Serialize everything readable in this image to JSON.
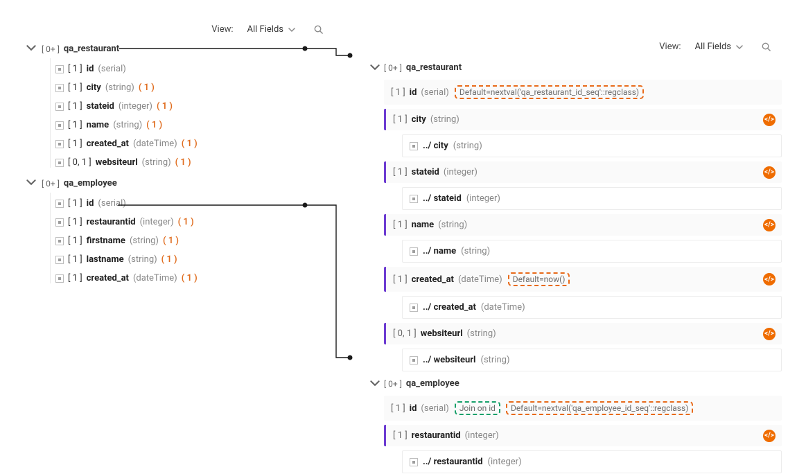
{
  "toolbar": {
    "view_label": "View:",
    "selected": "All Fields"
  },
  "left": {
    "groups": [
      {
        "card": "[ 0+ ]",
        "name": "qa_restaurant",
        "fields": [
          {
            "card": "[ 1 ]",
            "name": "id",
            "type": "(serial)",
            "count": ""
          },
          {
            "card": "[ 1 ]",
            "name": "city",
            "type": "(string)",
            "count": "( 1 )"
          },
          {
            "card": "[ 1 ]",
            "name": "stateid",
            "type": "(integer)",
            "count": "( 1 )"
          },
          {
            "card": "[ 1 ]",
            "name": "name",
            "type": "(string)",
            "count": "( 1 )"
          },
          {
            "card": "[ 1 ]",
            "name": "created_at",
            "type": "(dateTime)",
            "count": "( 1 )"
          },
          {
            "card": "[ 0, 1 ]",
            "name": "websiteurl",
            "type": "(string)",
            "count": "( 1 )"
          }
        ]
      },
      {
        "card": "[ 0+ ]",
        "name": "qa_employee",
        "fields": [
          {
            "card": "[ 1 ]",
            "name": "id",
            "type": "(serial)",
            "count": ""
          },
          {
            "card": "[ 1 ]",
            "name": "restaurantid",
            "type": "(integer)",
            "count": "( 1 )"
          },
          {
            "card": "[ 1 ]",
            "name": "firstname",
            "type": "(string)",
            "count": "( 1 )"
          },
          {
            "card": "[ 1 ]",
            "name": "lastname",
            "type": "(string)",
            "count": "( 1 )"
          },
          {
            "card": "[ 1 ]",
            "name": "created_at",
            "type": "(dateTime)",
            "count": "( 1 )"
          }
        ]
      }
    ]
  },
  "right": {
    "groups": [
      {
        "card": "[ 0+ ]",
        "name": "qa_restaurant",
        "fields": [
          {
            "card": "[ 1 ]",
            "name": "id",
            "type": "(serial)",
            "annot_orange": "Default=nextval('qa_restaurant_id_seq'::regclass)"
          },
          {
            "card": "[ 1 ]",
            "name": "city",
            "type": "(string)",
            "badge": true,
            "child": {
              "path": "../ city",
              "type": "(string)"
            }
          },
          {
            "card": "[ 1 ]",
            "name": "stateid",
            "type": "(integer)",
            "badge": true,
            "child": {
              "path": "../ stateid",
              "type": "(integer)"
            }
          },
          {
            "card": "[ 1 ]",
            "name": "name",
            "type": "(string)",
            "badge": true,
            "child": {
              "path": "../ name",
              "type": "(string)"
            }
          },
          {
            "card": "[ 1 ]",
            "name": "created_at",
            "type": "(dateTime)",
            "annot_orange": "Default=now()",
            "badge": true,
            "child": {
              "path": "../ created_at",
              "type": "(dateTime)"
            }
          },
          {
            "card": "[ 0, 1 ]",
            "name": "websiteurl",
            "type": "(string)",
            "badge": true,
            "child": {
              "path": "../ websiteurl",
              "type": "(string)"
            }
          }
        ]
      },
      {
        "card": "[ 0+ ]",
        "name": "qa_employee",
        "fields": [
          {
            "card": "[ 1 ]",
            "name": "id",
            "type": "(serial)",
            "annot_green": "Join on id",
            "annot_orange": "Default=nextval('qa_employee_id_seq'::regclass)"
          },
          {
            "card": "[ 1 ]",
            "name": "restaurantid",
            "type": "(integer)",
            "badge": true,
            "child": {
              "path": "../ restaurantid",
              "type": "(integer)"
            }
          }
        ]
      }
    ]
  }
}
